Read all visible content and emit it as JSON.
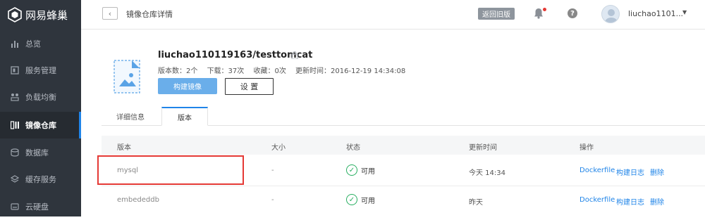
{
  "app": {
    "logo_text": "网易蜂巢"
  },
  "sidebar": {
    "items": [
      {
        "label": "总览",
        "icon": "bar-chart-icon",
        "active": false
      },
      {
        "label": "服务管理",
        "icon": "service-icon",
        "active": false
      },
      {
        "label": "负载均衡",
        "icon": "load-balancer-icon",
        "active": false
      },
      {
        "label": "镜像仓库",
        "icon": "image-repo-icon",
        "active": true
      },
      {
        "label": "数据库",
        "icon": "database-icon",
        "active": false
      },
      {
        "label": "缓存服务",
        "icon": "cache-icon",
        "active": false
      },
      {
        "label": "云硬盘",
        "icon": "disk-icon",
        "active": false
      }
    ]
  },
  "header": {
    "back_icon": "chevron-left-icon",
    "title": "镜像仓库详情",
    "old_version_label": "返回旧版",
    "username": "liuchao1101...",
    "icons": [
      "bell-icon",
      "help-icon",
      "avatar",
      "caret-down-icon"
    ]
  },
  "repo": {
    "name": "liuchao110119163/testtomcat",
    "meta": {
      "versions": "版本数：2个",
      "downloads": "下载：37次",
      "favorites": "收藏：0次",
      "updated": "更新时间：2016-12-19 14:34:08"
    },
    "build_label": "构建镜像",
    "settings_label": "设 置"
  },
  "tabs": [
    {
      "label": "详细信息",
      "active": false
    },
    {
      "label": "版本",
      "active": true
    }
  ],
  "table": {
    "headers": [
      "版本",
      "大小",
      "状态",
      "更新时间",
      "操作"
    ],
    "rows": [
      {
        "version": "mysql",
        "size": "-",
        "status": "可用",
        "updated": "今天 14:34",
        "actions": [
          "Dockerfile",
          "构建日志",
          "删除"
        ]
      },
      {
        "version": "embededdb",
        "size": "-",
        "status": "可用",
        "updated": "昨天",
        "actions": [
          "Dockerfile",
          "构建日志",
          "删除"
        ]
      }
    ]
  },
  "colors": {
    "sidebar_bg": "#2f353d",
    "accent": "#1f84e8",
    "build_button": "#6aaeea",
    "status_ok": "#27ae60",
    "highlight": "#e53935"
  }
}
